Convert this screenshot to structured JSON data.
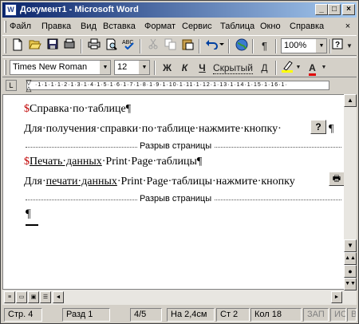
{
  "window": {
    "title": "Документ1 - Microsoft Word",
    "app_icon_letter": "W",
    "controls": [
      "minimize",
      "maximize",
      "close"
    ]
  },
  "menubar": {
    "items": [
      "Файл",
      "Правка",
      "Вид",
      "Вставка",
      "Формат",
      "Сервис",
      "Таблица",
      "Окно",
      "Справка"
    ],
    "close_glyph": "×"
  },
  "standard_toolbar": {
    "zoom": "100%",
    "buttons": [
      "new-document-icon",
      "open-icon",
      "save-icon",
      "permission-icon",
      "print-icon",
      "print-preview-icon",
      "spelling-icon",
      "cut-icon",
      "copy-icon",
      "paste-icon",
      "undo-icon",
      "web-globe-icon",
      "show-formatting-icon",
      "help-icon"
    ]
  },
  "formatting_toolbar": {
    "font": "Times New Roman",
    "size": "12",
    "bold": "Ж",
    "italic": "К",
    "underline": "Ч",
    "hidden_label": "Скрытый",
    "underline_double": "Д",
    "font_color_letter": "A"
  },
  "document": {
    "para1_marker": "$",
    "para1_text": "Справка·по·таблице¶",
    "para2_text": "Для·получения·справки·по·таблице·нажмите·кнопку·",
    "para2_end": "¶",
    "help_button_glyph": "?",
    "page_break_label": "Разрыв страницы",
    "para3_marker": "$",
    "para3_underlined": "Печать·данных",
    "para3_rest": "·Print·Page·таблицы¶",
    "para4_prefix": "Для·",
    "para4_underlined": "печати·данных",
    "para4_rest": "·Print·Page·таблицы·нажмите·кнопку",
    "page_break_label2": "Разрыв страницы",
    "para5_text": "¶"
  },
  "statusbar": {
    "page": "Стр. 4",
    "section": "Разд 1",
    "pages": "4/5",
    "position": "На 2,4см",
    "line": "Ст 2",
    "column": "Кол 18",
    "rec": "ЗАП",
    "trk": "ИС",
    "ext": "ВДЛ"
  },
  "colors": {
    "titlebar_start": "#0a246a",
    "titlebar_end": "#a6caf0",
    "marker_red": "#c00000",
    "chrome": "#d4d0c8"
  }
}
